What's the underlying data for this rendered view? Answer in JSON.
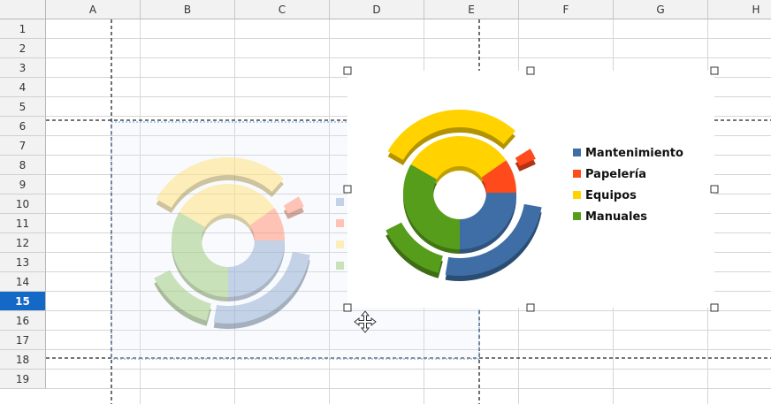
{
  "columns": [
    "A",
    "B",
    "C",
    "D",
    "E",
    "F",
    "G",
    "H"
  ],
  "rows": [
    "1",
    "2",
    "3",
    "4",
    "5",
    "6",
    "7",
    "8",
    "9",
    "10",
    "11",
    "12",
    "13",
    "14",
    "15",
    "16",
    "17",
    "18",
    "19"
  ],
  "selected_row": "15",
  "chart_data": [
    {
      "type": "donut",
      "state": "selected",
      "legend": [
        "Mantenimiento",
        "Papelería",
        "Equipos",
        "Manuales"
      ],
      "colors": [
        "#3e6ea5",
        "#ff4a1c",
        "#ffd200",
        "#579d1c"
      ]
    },
    {
      "type": "donut",
      "state": "ghost-preview",
      "legend": [
        "Mantenimiento",
        "Papelería",
        "Equipos",
        "Manuales"
      ],
      "colors": [
        "#9fb8d8",
        "#ffa08a",
        "#fbe38f",
        "#a9cf8f"
      ]
    }
  ],
  "icons": {
    "move_cursor": "move-cursor-icon"
  }
}
